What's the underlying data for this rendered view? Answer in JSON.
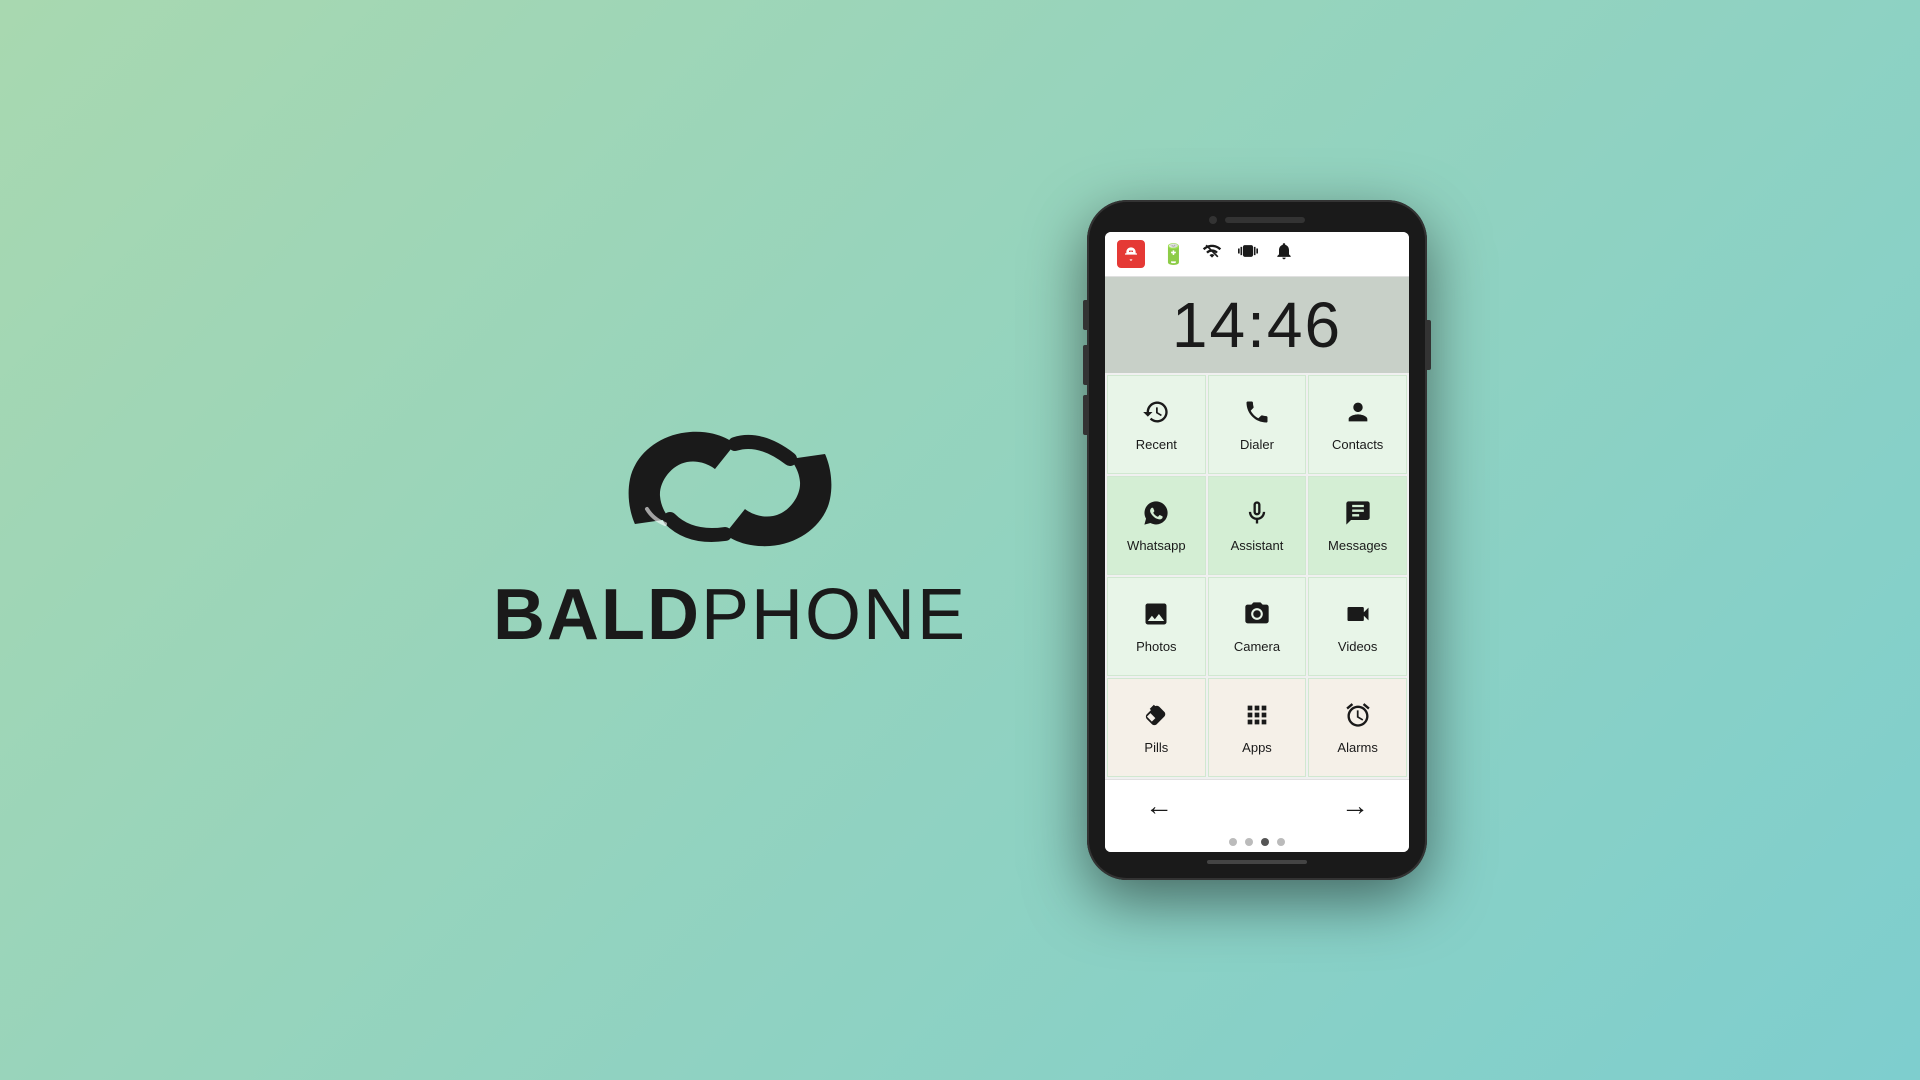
{
  "brand": {
    "bold_text": "BALD",
    "light_text": "PHONE"
  },
  "phone": {
    "time": "14:46",
    "status_icons": [
      "alarm",
      "battery",
      "signal",
      "vibrate",
      "bell"
    ],
    "apps": [
      {
        "id": "recent",
        "label": "Recent",
        "icon": "recent",
        "row": 1
      },
      {
        "id": "dialer",
        "label": "Dialer",
        "icon": "dialer",
        "row": 1
      },
      {
        "id": "contacts",
        "label": "Contacts",
        "icon": "contacts",
        "row": 1
      },
      {
        "id": "whatsapp",
        "label": "Whatsapp",
        "icon": "whatsapp",
        "row": 2
      },
      {
        "id": "assistant",
        "label": "Assistant",
        "icon": "assistant",
        "row": 2
      },
      {
        "id": "messages",
        "label": "Messages",
        "icon": "messages",
        "row": 2
      },
      {
        "id": "photos",
        "label": "Photos",
        "icon": "photos",
        "row": 3
      },
      {
        "id": "camera",
        "label": "Camera",
        "icon": "camera",
        "row": 3
      },
      {
        "id": "videos",
        "label": "Videos",
        "icon": "videos",
        "row": 3
      },
      {
        "id": "pills",
        "label": "Pills",
        "icon": "pills",
        "row": 4
      },
      {
        "id": "apps",
        "label": "Apps",
        "icon": "apps",
        "row": 4
      },
      {
        "id": "alarms",
        "label": "Alarms",
        "icon": "alarms",
        "row": 4
      }
    ],
    "nav": {
      "back": "←",
      "forward": "→"
    },
    "dots": [
      false,
      false,
      true,
      false
    ]
  }
}
